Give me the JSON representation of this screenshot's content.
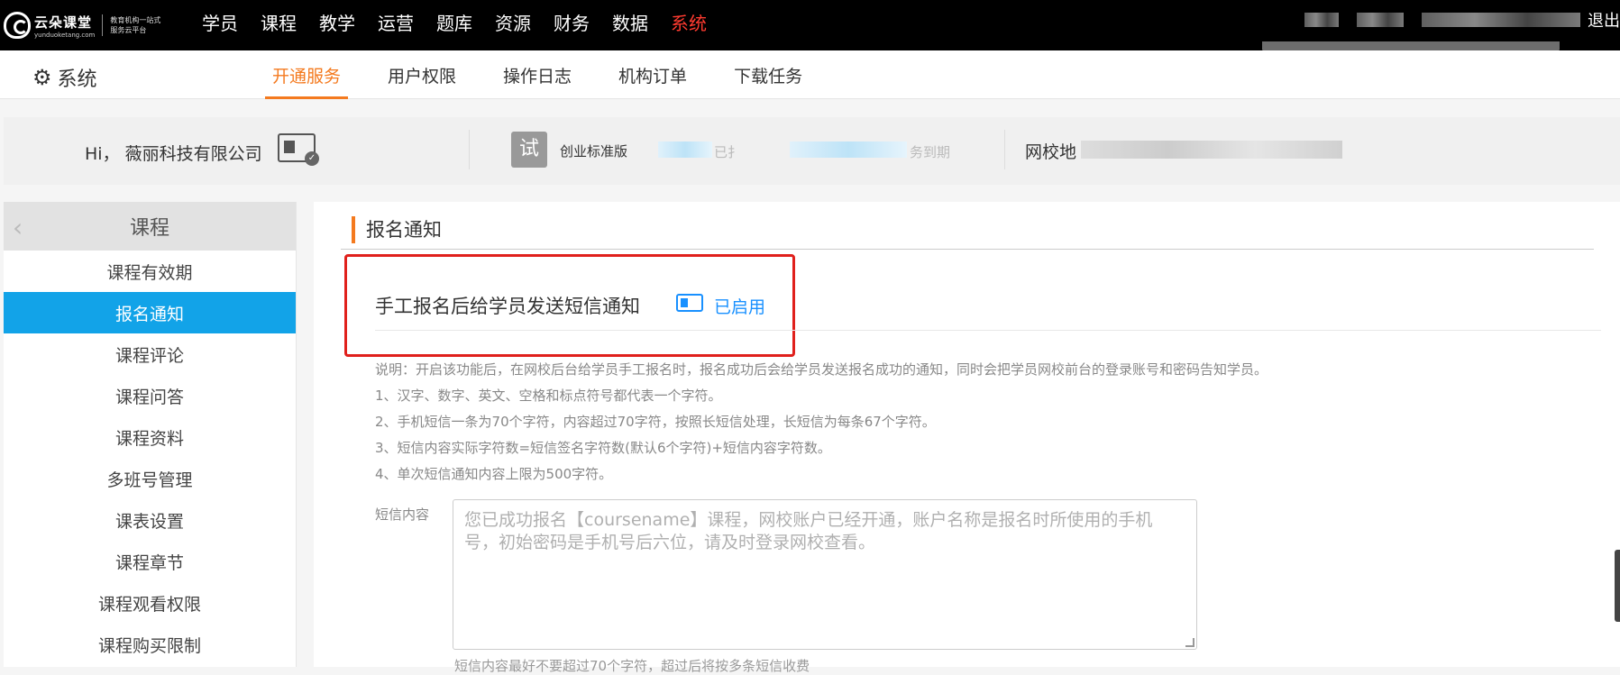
{
  "brand": {
    "name": "云朵课堂",
    "domain": "yunduoketang.com",
    "slogan": "教育机构一站式服务云平台"
  },
  "topnav": [
    {
      "label": "学员",
      "active": false
    },
    {
      "label": "课程",
      "active": false
    },
    {
      "label": "教学",
      "active": false
    },
    {
      "label": "运营",
      "active": false
    },
    {
      "label": "题库",
      "active": false
    },
    {
      "label": "资源",
      "active": false
    },
    {
      "label": "财务",
      "active": false
    },
    {
      "label": "数据",
      "active": false
    },
    {
      "label": "系统",
      "active": true
    }
  ],
  "logout_partial": "退出",
  "system_title": "系统",
  "subtabs": [
    {
      "label": "开通服务",
      "active": true
    },
    {
      "label": "用户权限",
      "active": false
    },
    {
      "label": "操作日志",
      "active": false
    },
    {
      "label": "机构订单",
      "active": false
    },
    {
      "label": "下载任务",
      "active": false
    }
  ],
  "info": {
    "greeting": "Hi， 薇丽科技有限公司",
    "trial_badge": "试",
    "edition": "创业标准版",
    "fragment1": "已扌",
    "fragment2": "务到期",
    "school_label": "网校地"
  },
  "sidebar": {
    "header": "课程",
    "items": [
      {
        "label": "课程有效期",
        "active": false
      },
      {
        "label": "报名通知",
        "active": true
      },
      {
        "label": "课程评论",
        "active": false
      },
      {
        "label": "课程问答",
        "active": false
      },
      {
        "label": "课程资料",
        "active": false
      },
      {
        "label": "多班号管理",
        "active": false
      },
      {
        "label": "课表设置",
        "active": false
      },
      {
        "label": "课程章节",
        "active": false
      },
      {
        "label": "课程观看权限",
        "active": false
      },
      {
        "label": "课程购买限制",
        "active": false
      }
    ]
  },
  "main": {
    "section_title": "报名通知",
    "sms_title": "手工报名后给学员发送短信通知",
    "status": "已启用",
    "notes": [
      "说明：开启该功能后，在网校后台给学员手工报名时，报名成功后会给学员发送报名成功的通知，同时会把学员网校前台的登录账号和密码告知学员。",
      "1、汉字、数字、英文、空格和标点符号都代表一个字符。",
      "2、手机短信一条为70个字符，内容超过70字符，按照长短信处理，长短信为每条67个字符。",
      "3、短信内容实际字符数=短信签名字符数(默认6个字符)+短信内容字符数。",
      "4、单次短信通知内容上限为500字符。"
    ],
    "content_label": "短信内容",
    "content_placeholder": "您已成功报名【coursename】课程，网校账户已经开通，账户名称是报名时所使用的手机号，初始密码是手机号后六位，请及时登录网校查看。",
    "hint": "短信内容最好不要超过70个字符，超过后将按多条短信收费"
  },
  "colors": {
    "accent_orange": "#f47a1f",
    "active_blue": "#12a3e8",
    "link_blue": "#1890ff",
    "highlight_red": "#e0201c",
    "nav_red": "#ff3b30"
  }
}
